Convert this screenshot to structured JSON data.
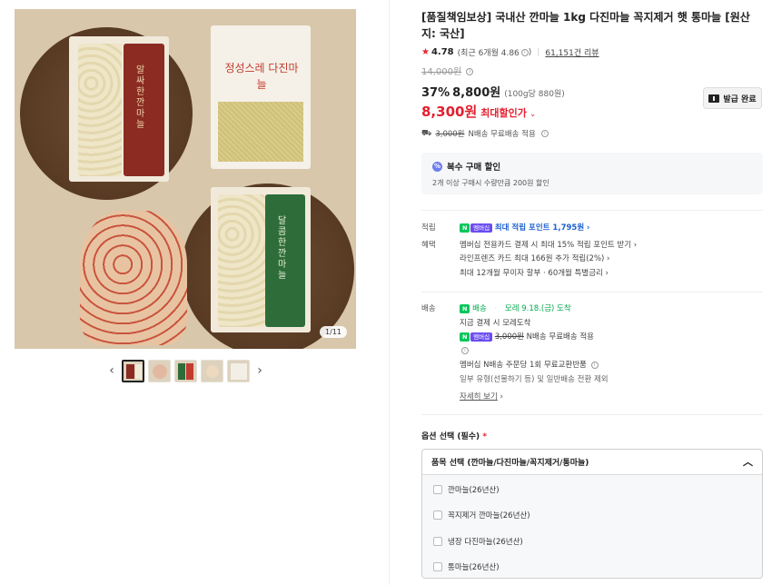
{
  "gallery": {
    "counter": "1/11",
    "prev_arrow": "‹",
    "next_arrow": "›",
    "package_labels": [
      "알싸한 깐마늘",
      "정성스레 다진마늘",
      "달콤한 깐마늘"
    ]
  },
  "product": {
    "title": "[품질책임보상] 국내산 깐마늘 1kg 다진마늘 꼭지제거 햇 통마늘 [원산지: 국산]",
    "rating": "4.78",
    "recent_rating": "(최근 6개월 4.86",
    "reviews": "61,151건 리뷰",
    "original_price": "14,000원",
    "discount_percent": "37%",
    "discount_price": "8,800원",
    "unit_price": "(100g당 880원)",
    "max_discount_price": "8,300원",
    "max_discount_label": "최대할인가",
    "coupon_button": "발급 완료",
    "shipping_orig": "3,000원",
    "shipping_text": "N배송 무료배송 적용"
  },
  "multi_discount": {
    "title": "복수 구매 할인",
    "desc": "2개 이상 구매시 수량만큼 200원 할인"
  },
  "points": {
    "label": "적립",
    "npay": "N",
    "member_badge": "멤버십",
    "text": "최대 적립 포인트 1,795원"
  },
  "benefits": {
    "label": "혜택",
    "lines": [
      "멤버십 전용카드 결제 시 최대 15% 적립 포인트 받기",
      "라인프렌즈 카드 최대 166원 추가 적립(2%)",
      "최대 12개월 무이자 할부 · 60개월 특별금리"
    ]
  },
  "delivery": {
    "label": "배송",
    "type": "배송",
    "arrival": "모레 9.18.(금) 도착",
    "pay_note": "지금 결제 시 모레도착",
    "fee_orig": "3,000원",
    "fee_text": "N배송 무료배송 적용",
    "return_note": "멤버십 N배송 주문당 1회 무료교환반품",
    "exclusion": "일부 유형(선물하기 등) 및 일반배송 전환 제외",
    "more_link": "자세히 보기"
  },
  "options": {
    "label": "옵션 선택 (필수)",
    "required_mark": "*",
    "select_title": "품목 선택 (깐마늘/다진마늘/꼭지제거/통마늘)",
    "items": [
      "깐마늘(26년산)",
      "꼭지제거 깐마늘(26년산)",
      "냉장 다진마늘(26년산)",
      "통마늘(26년산)"
    ]
  }
}
